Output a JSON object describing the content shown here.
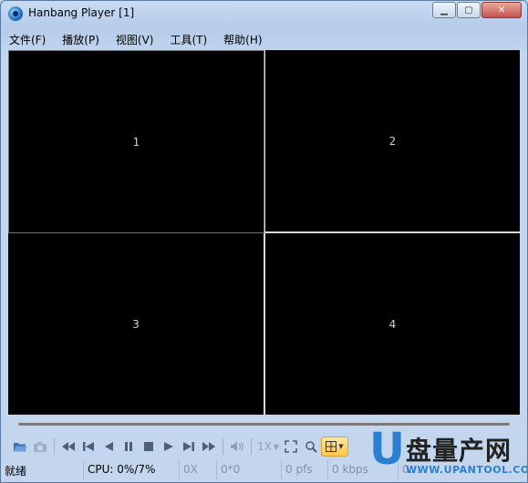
{
  "window": {
    "title": "Hanbang Player [1]"
  },
  "menu": [
    "文件(F)",
    "播放(P)",
    "视图(V)",
    "工具(T)",
    "帮助(H)"
  ],
  "grid": {
    "cells": [
      "1",
      "2",
      "3",
      "4"
    ],
    "active_cell": 1
  },
  "toolbar": {
    "speed": "1X",
    "icons": [
      "open-folder-icon",
      "snapshot-icon",
      "fast-rewind-icon",
      "skip-previous-icon",
      "step-back-icon",
      "pause-icon",
      "stop-icon",
      "play-icon",
      "skip-next-icon",
      "fast-forward-icon",
      "volume-icon",
      "speed-icon",
      "fullscreen-icon",
      "zoom-icon",
      "layout-grid-icon"
    ]
  },
  "status": {
    "ready": "就绪",
    "cpu": "CPU: 0%/7%",
    "multiplier": "0X",
    "time": "0*0",
    "fps": "0 pfs",
    "bitrate": "0 kbps",
    "extra": "0..."
  },
  "watermark": {
    "logo": "U",
    "text": "盘量产网",
    "sub": "WWW.UPANTOOL.COM"
  }
}
